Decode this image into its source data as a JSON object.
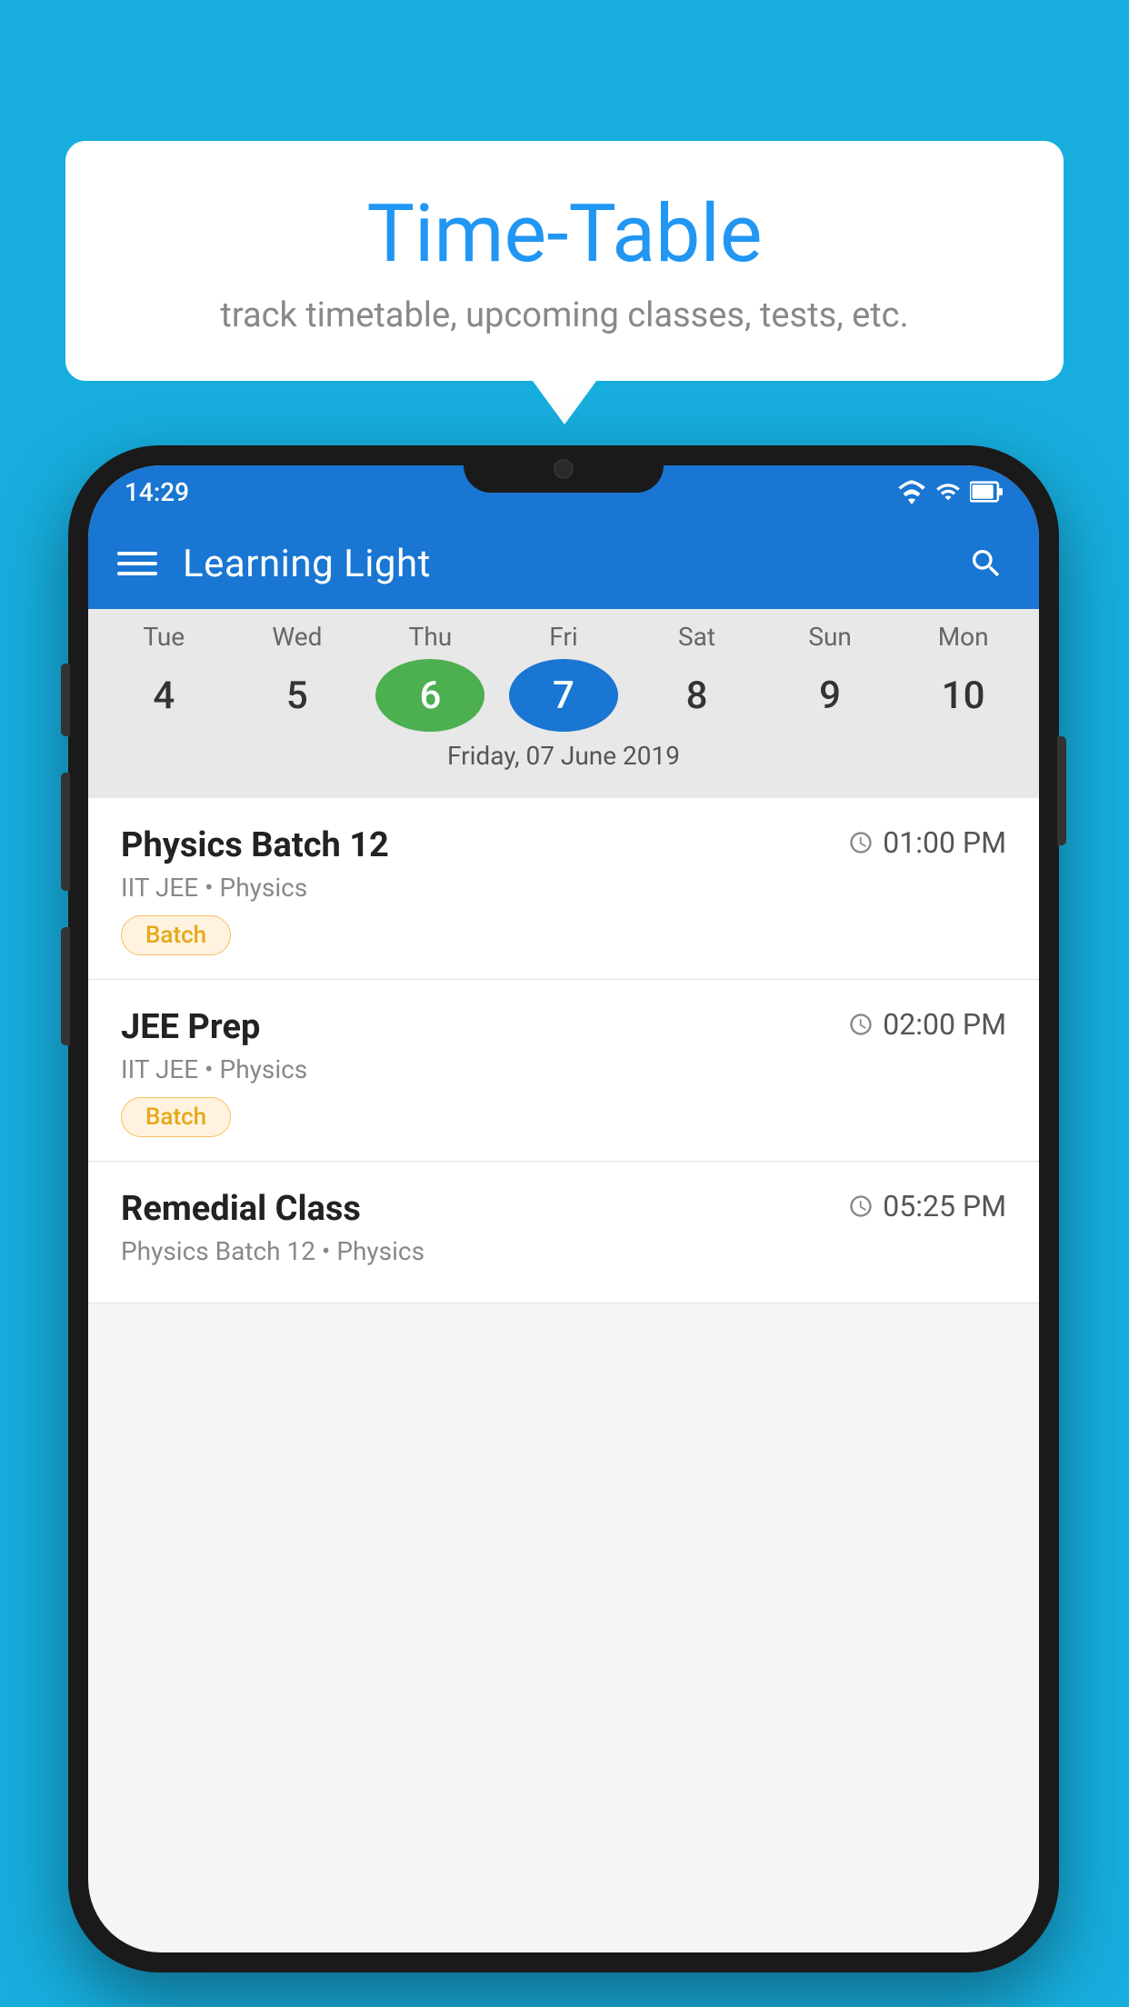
{
  "background_color": "#17AEDE",
  "speech_bubble": {
    "title": "Time-Table",
    "subtitle": "track timetable, upcoming classes, tests, etc."
  },
  "app_bar": {
    "title": "Learning Light"
  },
  "status_bar": {
    "time": "14:29"
  },
  "calendar": {
    "days": [
      "Tue",
      "Wed",
      "Thu",
      "Fri",
      "Sat",
      "Sun",
      "Mon"
    ],
    "dates": [
      "4",
      "5",
      "6",
      "7",
      "8",
      "9",
      "10"
    ],
    "today_index": 2,
    "selected_index": 3,
    "selected_label": "Friday, 07 June 2019"
  },
  "schedule": [
    {
      "title": "Physics Batch 12",
      "time": "01:00 PM",
      "subtitle": "IIT JEE • Physics",
      "badge": "Batch"
    },
    {
      "title": "JEE Prep",
      "time": "02:00 PM",
      "subtitle": "IIT JEE • Physics",
      "badge": "Batch"
    },
    {
      "title": "Remedial Class",
      "time": "05:25 PM",
      "subtitle": "Physics Batch 12 • Physics",
      "badge": ""
    }
  ]
}
